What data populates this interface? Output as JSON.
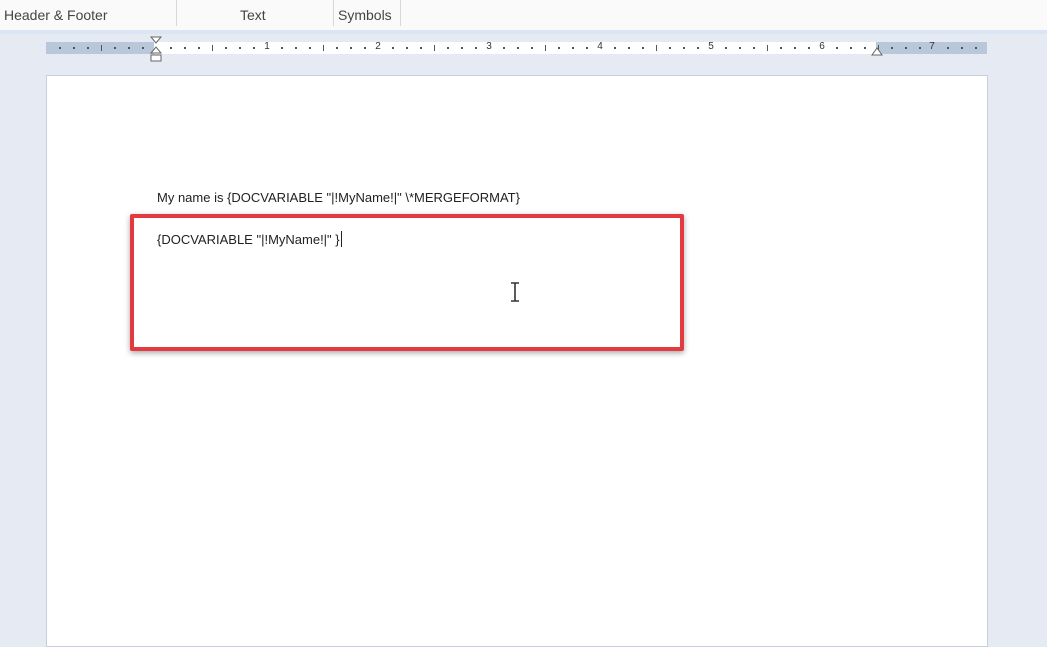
{
  "ribbon": {
    "groups": [
      {
        "label": "Header & Footer"
      },
      {
        "label": "Text"
      },
      {
        "label": "Symbols"
      }
    ]
  },
  "ruler": {
    "numbers": [
      "1",
      "2",
      "3",
      "4",
      "5",
      "6",
      "7"
    ]
  },
  "document": {
    "line1": "My name is {DOCVARIABLE \"|!MyName!|\" \\*MERGEFORMAT}",
    "line2": "{DOCVARIABLE \"|!MyName!|\" }"
  },
  "colors": {
    "highlight": "#e23a3e",
    "ruler_margin": "#b9c7db"
  },
  "icons": {
    "cursor": "i-beam-cursor-icon",
    "indent": "indent-marker-icon"
  }
}
